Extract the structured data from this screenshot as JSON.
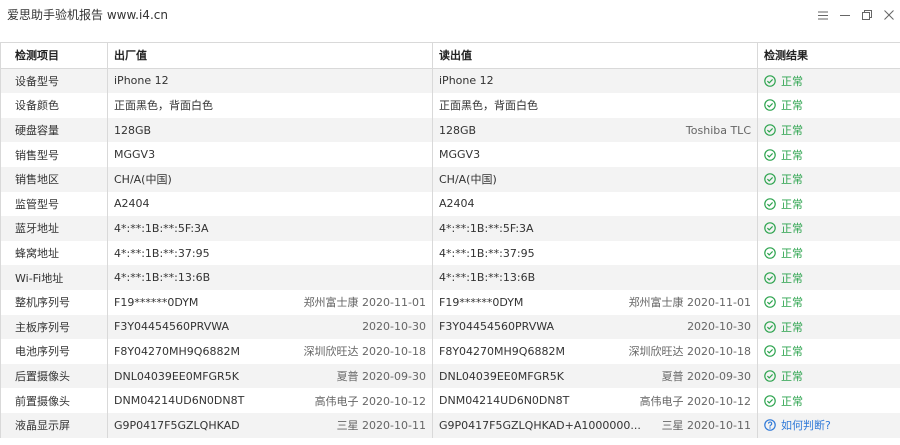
{
  "window": {
    "title": "爱思助手验机报告 www.i4.cn"
  },
  "table": {
    "headers": {
      "item": "检测项目",
      "factory": "出厂值",
      "read": "读出值",
      "result": "检测结果"
    },
    "rows": [
      {
        "item": "设备型号",
        "factory": "iPhone 12",
        "factory_meta": "",
        "read": "iPhone 12",
        "read_meta": "",
        "result": "正常",
        "status": "ok"
      },
      {
        "item": "设备颜色",
        "factory": "正面黑色，背面白色",
        "factory_meta": "",
        "read": "正面黑色，背面白色",
        "read_meta": "",
        "result": "正常",
        "status": "ok"
      },
      {
        "item": "硬盘容量",
        "factory": "128GB",
        "factory_meta": "",
        "read": "128GB",
        "read_meta": "Toshiba TLC",
        "result": "正常",
        "status": "ok"
      },
      {
        "item": "销售型号",
        "factory": "MGGV3",
        "factory_meta": "",
        "read": "MGGV3",
        "read_meta": "",
        "result": "正常",
        "status": "ok"
      },
      {
        "item": "销售地区",
        "factory": "CH/A(中国)",
        "factory_meta": "",
        "read": "CH/A(中国)",
        "read_meta": "",
        "result": "正常",
        "status": "ok"
      },
      {
        "item": "监管型号",
        "factory": "A2404",
        "factory_meta": "",
        "read": "A2404",
        "read_meta": "",
        "result": "正常",
        "status": "ok"
      },
      {
        "item": "蓝牙地址",
        "factory": "4*:**:1B:**:5F:3A",
        "factory_meta": "",
        "read": "4*:**:1B:**:5F:3A",
        "read_meta": "",
        "result": "正常",
        "status": "ok"
      },
      {
        "item": "蜂窝地址",
        "factory": "4*:**:1B:**:37:95",
        "factory_meta": "",
        "read": "4*:**:1B:**:37:95",
        "read_meta": "",
        "result": "正常",
        "status": "ok"
      },
      {
        "item": "Wi-Fi地址",
        "factory": "4*:**:1B:**:13:6B",
        "factory_meta": "",
        "read": "4*:**:1B:**:13:6B",
        "read_meta": "",
        "result": "正常",
        "status": "ok"
      },
      {
        "item": "整机序列号",
        "factory": "F19******0DYM",
        "factory_meta": "郑州富士康 2020-11-01",
        "read": "F19******0DYM",
        "read_meta": "郑州富士康 2020-11-01",
        "result": "正常",
        "status": "ok"
      },
      {
        "item": "主板序列号",
        "factory": "F3Y04454560PRVWA",
        "factory_meta": "2020-10-30",
        "read": "F3Y04454560PRVWA",
        "read_meta": "2020-10-30",
        "result": "正常",
        "status": "ok"
      },
      {
        "item": "电池序列号",
        "factory": "F8Y04270MH9Q6882M",
        "factory_meta": "深圳欣旺达 2020-10-18",
        "read": "F8Y04270MH9Q6882M",
        "read_meta": "深圳欣旺达 2020-10-18",
        "result": "正常",
        "status": "ok"
      },
      {
        "item": "后置摄像头",
        "factory": "DNL04039EE0MFGR5K",
        "factory_meta": "夏普 2020-09-30",
        "read": "DNL04039EE0MFGR5K",
        "read_meta": "夏普 2020-09-30",
        "result": "正常",
        "status": "ok"
      },
      {
        "item": "前置摄像头",
        "factory": "DNM04214UD6N0DN8T",
        "factory_meta": "高伟电子 2020-10-12",
        "read": "DNM04214UD6N0DN8T",
        "read_meta": "高伟电子 2020-10-12",
        "result": "正常",
        "status": "ok"
      },
      {
        "item": "液晶显示屏",
        "factory": "G9P0417F5GZLQHKAD",
        "factory_meta": "三星 2020-10-11",
        "read": "G9P0417F5GZLQHKAD+A1000000...",
        "read_meta": "三星 2020-10-11",
        "result": "如何判断?",
        "status": "help"
      }
    ]
  },
  "colors": {
    "ok": "#2ea44f",
    "help": "#2f79d8",
    "stripe": "#f3f3f3"
  },
  "icons": {
    "ok": "check-circle-icon",
    "help": "question-circle-icon"
  }
}
